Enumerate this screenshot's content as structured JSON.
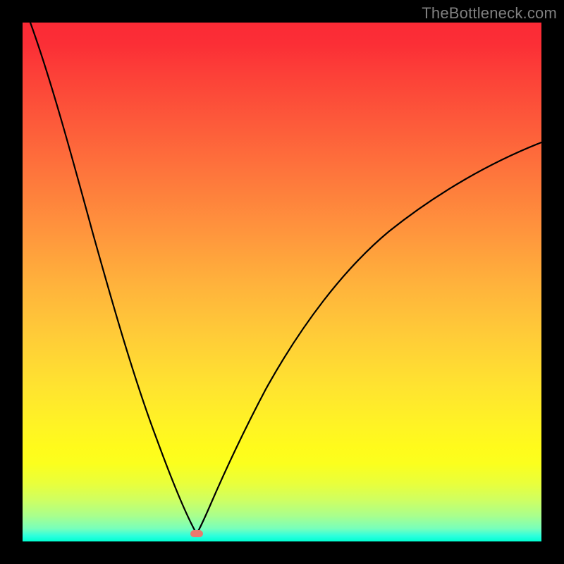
{
  "watermark": "TheBottleneck.com",
  "colors": {
    "frame": "#000000",
    "curve_stroke": "#000000",
    "marker": "#e97a6e",
    "gradient_top": "#fb2a35",
    "gradient_bottom": "#00ffd0"
  },
  "chart_data": {
    "type": "line",
    "title": "",
    "xlabel": "",
    "ylabel": "",
    "xlim": [
      0,
      1
    ],
    "ylim": [
      0,
      1
    ],
    "annotations": [
      "TheBottleneck.com"
    ],
    "marker": {
      "x": 0.335,
      "y": 0.985
    },
    "grid": false,
    "legend": false,
    "series": [
      {
        "name": "left-branch",
        "x": [
          0.015,
          0.06,
          0.118,
          0.175,
          0.23,
          0.275,
          0.305,
          0.32,
          0.33,
          0.335
        ],
        "y": [
          0.0,
          0.15,
          0.34,
          0.52,
          0.69,
          0.82,
          0.91,
          0.955,
          0.978,
          0.985
        ]
      },
      {
        "name": "right-branch",
        "x": [
          0.335,
          0.345,
          0.365,
          0.4,
          0.45,
          0.52,
          0.6,
          0.7,
          0.82,
          0.94,
          1.0
        ],
        "y": [
          0.985,
          0.955,
          0.89,
          0.79,
          0.68,
          0.57,
          0.47,
          0.38,
          0.3,
          0.24,
          0.215
        ]
      }
    ]
  }
}
